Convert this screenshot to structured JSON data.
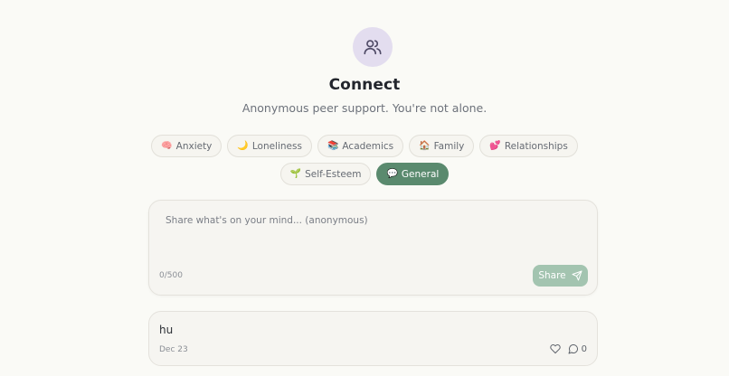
{
  "header": {
    "icon": "users-icon",
    "title": "Connect",
    "subtitle": "Anonymous peer support. You're not alone."
  },
  "categories": [
    {
      "emoji": "🧠",
      "label": "Anxiety",
      "active": false
    },
    {
      "emoji": "🌙",
      "label": "Loneliness",
      "active": false
    },
    {
      "emoji": "📚",
      "label": "Academics",
      "active": false
    },
    {
      "emoji": "🏠",
      "label": "Family",
      "active": false
    },
    {
      "emoji": "💕",
      "label": "Relationships",
      "active": false
    },
    {
      "emoji": "🌱",
      "label": "Self-Esteem",
      "active": false
    },
    {
      "emoji": "💬",
      "label": "General",
      "active": true
    }
  ],
  "composer": {
    "placeholder": "Share what's on your mind... (anonymous)",
    "value": "",
    "counter": "0/500",
    "share_label": "Share",
    "share_icon": "send-icon"
  },
  "posts": [
    {
      "text": "hu",
      "date": "Dec 23",
      "like_icon": "heart-icon",
      "comment_icon": "comment-icon",
      "comment_count": "0"
    }
  ],
  "colors": {
    "accent": "#5a8a6e",
    "accent_light": "#a3c4b0",
    "background": "#fafaf6",
    "icon_bg": "#e3ddef"
  }
}
